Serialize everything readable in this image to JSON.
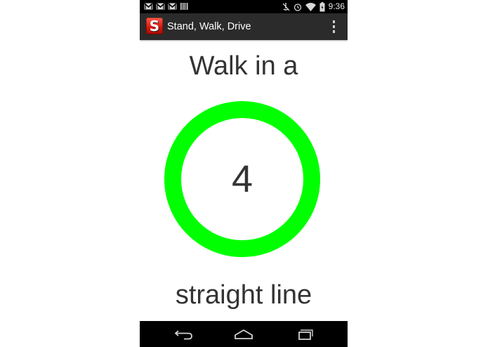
{
  "status_bar": {
    "time": "9:36",
    "left_icons": [
      "gmail-icon",
      "gmail-icon",
      "gmail-icon",
      "barcode-icon"
    ],
    "right_icons": [
      "mute-icon",
      "alarm-icon",
      "wifi-icon",
      "battery-icon"
    ]
  },
  "action_bar": {
    "app_icon_letter": "S",
    "title": "Stand, Walk, Drive",
    "overflow_icon": "overflow-menu-icon"
  },
  "content": {
    "instruction_top": "Walk in a",
    "countdown": "4",
    "instruction_bottom": "straight line",
    "ring_color": "#00ff00"
  },
  "nav_bar": {
    "buttons": [
      "back-icon",
      "home-icon",
      "recents-icon"
    ]
  }
}
